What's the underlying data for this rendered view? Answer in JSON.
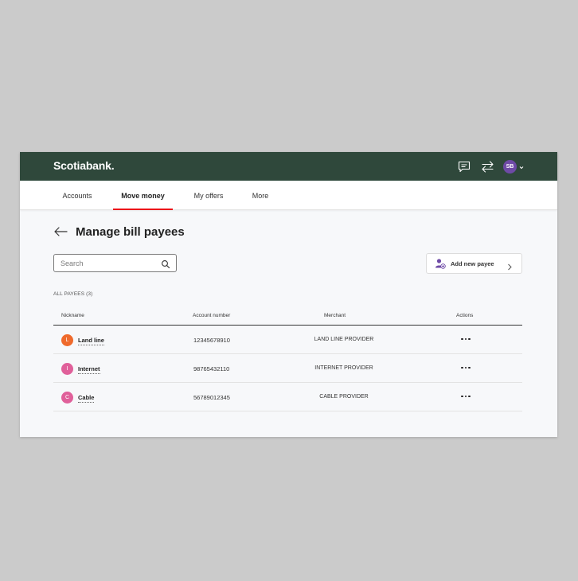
{
  "app": {
    "brand": "Scotiabank."
  },
  "header": {
    "icons": [
      "message-icon",
      "transfer-arrows-icon"
    ],
    "avatar_initials": "SB",
    "avatar_color": "#6e4aa6",
    "bar_color": "#2f483b"
  },
  "nav": {
    "tabs": [
      {
        "label": "Accounts",
        "active": false
      },
      {
        "label": "Move money",
        "active": true
      },
      {
        "label": "My offers",
        "active": false
      },
      {
        "label": "More",
        "active": false
      }
    ],
    "active_color": "#ec111a"
  },
  "page": {
    "title": "Manage bill payees",
    "search": {
      "placeholder": "Search",
      "value": ""
    },
    "add_button": "Add new payee",
    "list_label": "ALL PAYEES (3)"
  },
  "table": {
    "columns": [
      "Nickname",
      "Account number",
      "Merchant",
      "Actions"
    ],
    "rows": [
      {
        "initial": "L",
        "color": "#ef6a2c",
        "nickname": "Land line",
        "account": "12345678910",
        "merchant": "LAND LINE PROVIDER"
      },
      {
        "initial": "I",
        "color": "#e0609a",
        "nickname": "Internet",
        "account": "98765432110",
        "merchant": "INTERNET PROVIDER"
      },
      {
        "initial": "C",
        "color": "#e0609a",
        "nickname": "Cable",
        "account": "56789012345",
        "merchant": "CABLE PROVIDER"
      }
    ]
  }
}
